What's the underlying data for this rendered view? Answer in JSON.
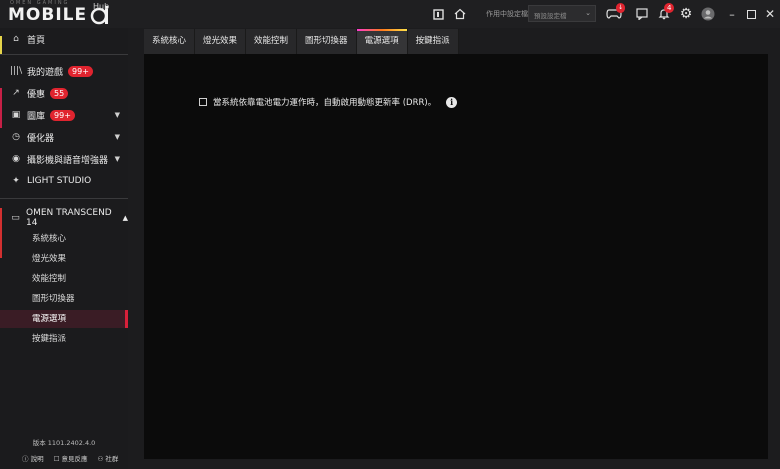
{
  "header": {
    "logo_text": "MOBILE",
    "logo_hub": "Hub",
    "logo_small": "OMEN GAMING",
    "profile_label": "作用中設定檔",
    "profile_value": "預設設定檔",
    "notifications_count": "4",
    "download_badge": "↓"
  },
  "sidebar": {
    "home": "首頁",
    "my_games": "我的遊戲",
    "my_games_badge": "99+",
    "deals": "優惠",
    "deals_badge": "55",
    "gallery": "圖庫",
    "gallery_badge": "99+",
    "optimizer": "優化器",
    "camera_audio": "攝影機與語音增強器",
    "light_studio": "LIGHT STUDIO",
    "device": "OMEN TRANSCEND 14",
    "sub_items": [
      "系統核心",
      "燈光效果",
      "效能控制",
      "圖形切換器",
      "電源選項",
      "按鍵指派"
    ],
    "version": "版本 1101.2402.4.0",
    "footer_help": "說明",
    "footer_feedback": "意見反應",
    "footer_community": "社群"
  },
  "tabs": [
    "系統核心",
    "燈光效果",
    "效能控制",
    "圖形切換器",
    "電源選項",
    "按鍵指派"
  ],
  "active_tab_index": 4,
  "content": {
    "option_label": "當系統依靠電池電力運作時，自動啟用動態更新率 (DRR)。",
    "option_checked": false
  },
  "colors": {
    "accent_red": "#e0242f",
    "active_bg": "#3a1c25",
    "tab_gradient": [
      "#ff3bd1",
      "#ff7a1a",
      "#ffe14a"
    ]
  }
}
